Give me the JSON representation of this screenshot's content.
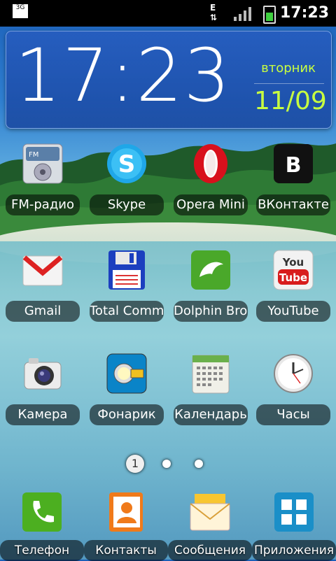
{
  "status_bar": {
    "time": "17:23",
    "network": "3G",
    "data_indicator": "E"
  },
  "clock_widget": {
    "time": "17:23",
    "weekday": "вторник",
    "date": "11/09"
  },
  "apps": [
    {
      "label": "FM-радио",
      "icon": "fm-radio-icon"
    },
    {
      "label": "Skype",
      "icon": "skype-icon"
    },
    {
      "label": "Opera Mini",
      "icon": "opera-icon"
    },
    {
      "label": "ВКонтакте",
      "icon": "vk-icon"
    },
    {
      "label": "Gmail",
      "icon": "gmail-icon"
    },
    {
      "label": "Total Commander",
      "icon": "floppy-icon"
    },
    {
      "label": "Dolphin Browser",
      "icon": "dolphin-icon"
    },
    {
      "label": "YouTube",
      "icon": "youtube-icon"
    },
    {
      "label": "Камера",
      "icon": "camera-icon"
    },
    {
      "label": "Фонарик",
      "icon": "flashlight-icon"
    },
    {
      "label": "Календарь",
      "icon": "calendar-icon"
    },
    {
      "label": "Часы",
      "icon": "clock-icon"
    }
  ],
  "pager": {
    "current_page": "1"
  },
  "dock": [
    {
      "label": "Телефон",
      "icon": "phone-icon"
    },
    {
      "label": "Контакты",
      "icon": "contacts-icon"
    },
    {
      "label": "Сообщения",
      "icon": "messages-icon"
    },
    {
      "label": "Приложения",
      "icon": "apps-grid-icon"
    }
  ],
  "colors": {
    "clock_accent": "#c8ff40",
    "dock_phone": "#4caf20",
    "opera_red": "#d8101c"
  }
}
